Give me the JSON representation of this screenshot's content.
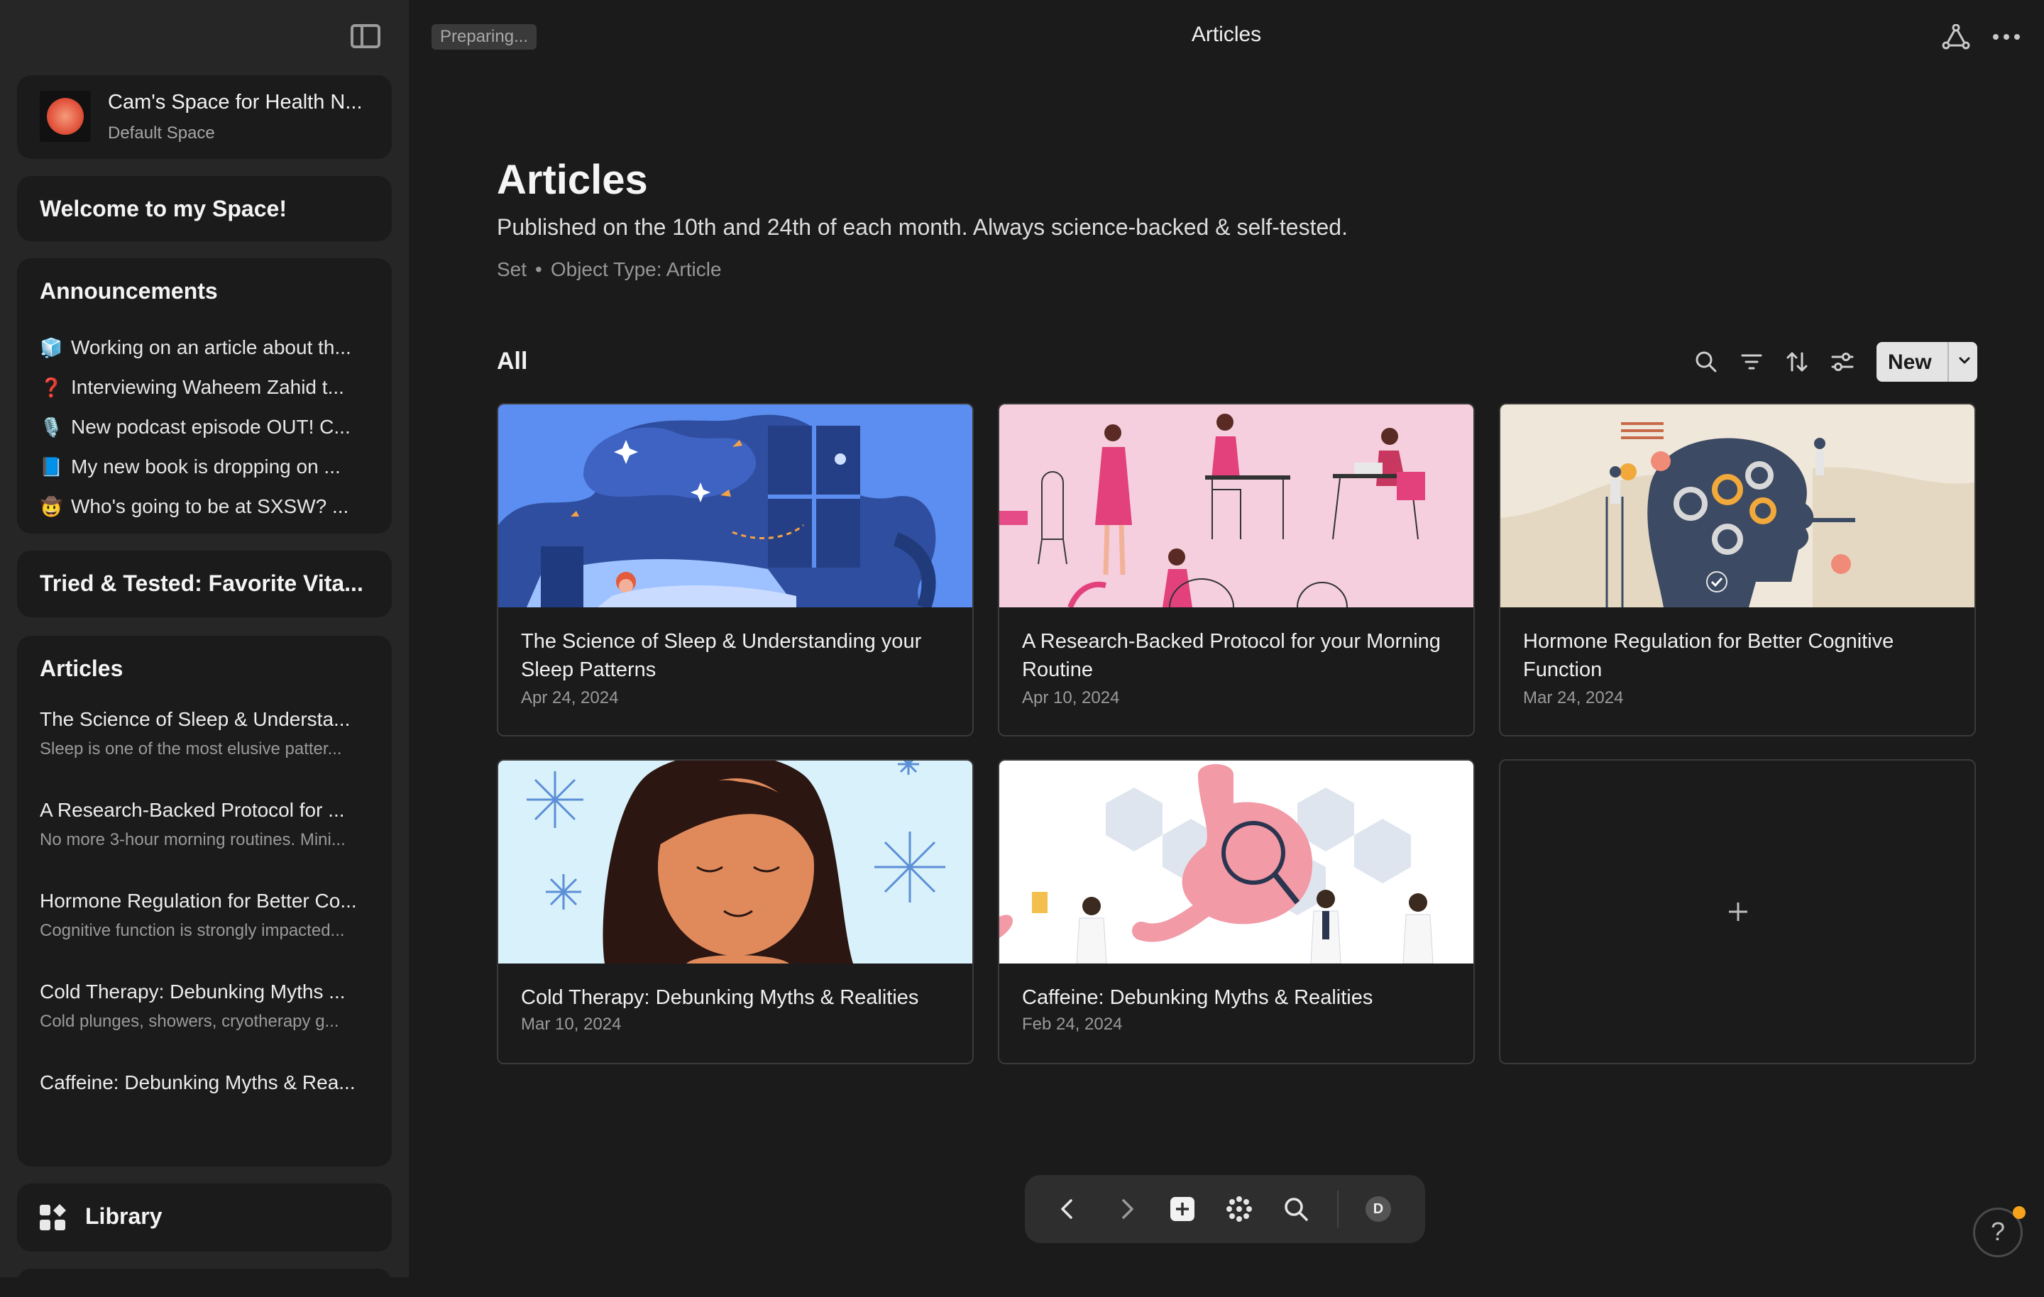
{
  "sidebar": {
    "space": {
      "name": "Cam's Space for Health N...",
      "type": "Default Space"
    },
    "welcome": {
      "title": "Welcome to my Space!"
    },
    "announcements": {
      "title": "Announcements",
      "items": [
        {
          "emoji": "🧊",
          "text": "Working on an article about th..."
        },
        {
          "emoji": "❓",
          "text": "Interviewing Waheem Zahid t..."
        },
        {
          "emoji": "🎙️",
          "text": "New podcast episode OUT! C..."
        },
        {
          "emoji": "📘",
          "text": "My new book is dropping on ..."
        },
        {
          "emoji": "🤠",
          "text": "Who's going to be at SXSW? ..."
        }
      ]
    },
    "tried": {
      "title": "Tried & Tested: Favorite Vita..."
    },
    "articles": {
      "title": "Articles",
      "items": [
        {
          "title": "The Science of Sleep & Understa...",
          "snippet": "Sleep is one of the most elusive patter..."
        },
        {
          "title": "A Research-Backed Protocol for ...",
          "snippet": "No more 3-hour morning routines. Mini..."
        },
        {
          "title": "Hormone Regulation for Better Co...",
          "snippet": "Cognitive function is strongly impacted..."
        },
        {
          "title": "Cold Therapy: Debunking Myths ...",
          "snippet": "Cold plunges, showers, cryotherapy g..."
        },
        {
          "title": "Caffeine: Debunking Myths & Rea...",
          "snippet": ""
        }
      ]
    },
    "library": {
      "label": "Library"
    }
  },
  "topbar": {
    "status": "Preparing...",
    "title": "Articles"
  },
  "page": {
    "title": "Articles",
    "description": "Published on the 10th and 24th of each month. Always science-backed & self-tested.",
    "meta_set": "Set",
    "meta_sep": "•",
    "meta_type": "Object Type: Article",
    "view": "All",
    "new_label": "New"
  },
  "cards": [
    {
      "title": "The Science of Sleep & Understanding your Sleep Patterns",
      "date": "Apr 24, 2024"
    },
    {
      "title": "A Research-Backed Protocol for your Morning Routine",
      "date": "Apr 10, 2024"
    },
    {
      "title": "Hormone Regulation for Better Cognitive Function",
      "date": "Mar 24, 2024"
    },
    {
      "title": "Cold Therapy: Debunking Myths & Realities",
      "date": "Mar 10, 2024"
    },
    {
      "title": "Caffeine: Debunking Myths & Realities",
      "date": "Feb 24, 2024"
    }
  ],
  "dock": {
    "avatar": "D"
  },
  "help": {
    "label": "?"
  },
  "colors": {
    "accent": "#f6a21b",
    "background": "#1b1b1b",
    "sidebar": "#262626"
  }
}
